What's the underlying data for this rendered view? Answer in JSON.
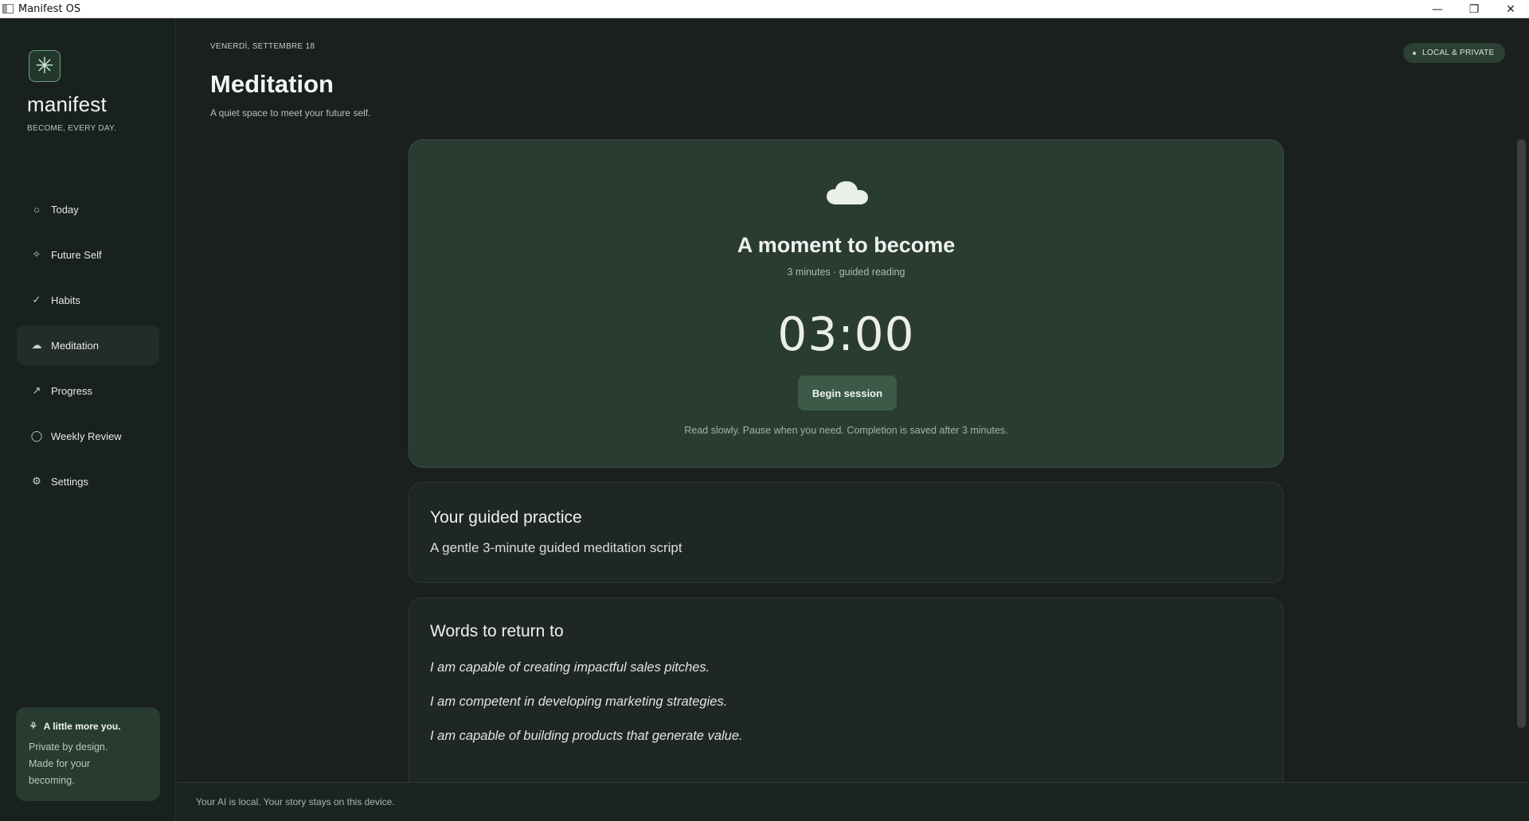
{
  "window": {
    "title": "Manifest OS",
    "controls": {
      "minimize": "—",
      "maximize": "❐",
      "close": "✕"
    }
  },
  "sidebar": {
    "brand": "manifest",
    "tagline": "BECOME, EVERY DAY.",
    "logo_icon": "asterisk-icon",
    "items": [
      {
        "label": "Today",
        "icon": "circle-icon",
        "glyph": "○",
        "active": false
      },
      {
        "label": "Future Self",
        "icon": "sparkle-icon",
        "glyph": "✧",
        "active": false
      },
      {
        "label": "Habits",
        "icon": "check-icon",
        "glyph": "✓",
        "active": false
      },
      {
        "label": "Meditation",
        "icon": "cloud-icon",
        "glyph": "☁",
        "active": true
      },
      {
        "label": "Progress",
        "icon": "trend-arrow-icon",
        "glyph": "↗",
        "active": false
      },
      {
        "label": "Weekly Review",
        "icon": "ring-icon",
        "glyph": "◯",
        "active": false
      },
      {
        "label": "Settings",
        "icon": "gear-icon",
        "glyph": "⚙",
        "active": false
      }
    ],
    "card": {
      "title": "A little more you.",
      "icon": "sprout-icon",
      "body": "Private by design. Made for your becoming."
    }
  },
  "header": {
    "date": "VENERDÌ, SETTEMBRE 18",
    "title": "Meditation",
    "subtitle": "A quiet space to meet your future self.",
    "privacy_badge": "LOCAL & PRIVATE"
  },
  "session": {
    "title": "A moment to become",
    "meta": "3 minutes · guided reading",
    "timer": "03:00",
    "button": "Begin session",
    "note": "Read slowly. Pause when you need. Completion is saved after 3 minutes."
  },
  "practice": {
    "title": "Your guided practice",
    "description": "A gentle 3-minute guided meditation script"
  },
  "words": {
    "title": "Words to return to",
    "affirmations": [
      "I am capable of creating impactful sales pitches.",
      "I am competent in developing marketing strategies.",
      "I am capable of building products that generate value."
    ]
  },
  "footer": {
    "text": "Your AI is local. Your story stays on this device."
  },
  "colors": {
    "background": "#1a201d",
    "sidebar": "#18211d",
    "hero_card": "#2a3b32",
    "accent_button": "#3d5a49",
    "text": "#e6ebe7"
  }
}
